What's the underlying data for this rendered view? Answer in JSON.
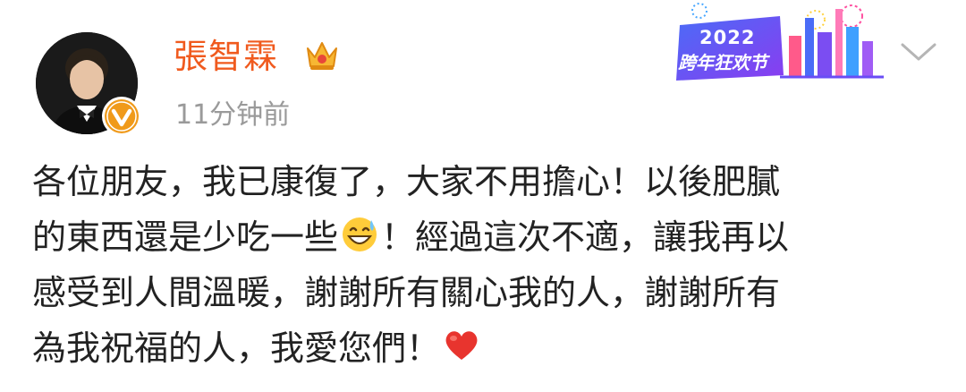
{
  "user": {
    "name": "張智霖",
    "timestamp": "11分钟前",
    "verified_badge_color": "#f09a1a",
    "name_color": "#f05a1e"
  },
  "badge": {
    "year": "2022",
    "name": "跨年狂欢节",
    "icon": "cityscape-fireworks-badge"
  },
  "menu": {
    "icon": "chevron-down-icon"
  },
  "post": {
    "line1": "各位朋友，我已康復了，大家不用擔心！以後肥膩",
    "line2_before": "的東西還是少吃一些",
    "line2_emoji": "grinning-sweat-emoji",
    "line2_after": "！經過這次不適，讓我再以",
    "line3": "感受到人間溫暖，謝謝所有關心我的人，謝謝所有",
    "line4_before": "為我祝福的人，我愛您們！",
    "line4_emoji": "red-heart-emoji"
  }
}
